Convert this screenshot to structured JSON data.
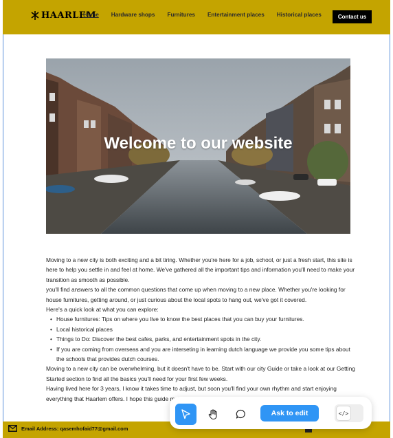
{
  "header": {
    "logo_text": "HAARLEM",
    "nav": [
      {
        "label": "Home",
        "active": true
      },
      {
        "label": "Hardware shops",
        "active": false
      },
      {
        "label": "Furnitures",
        "active": false
      },
      {
        "label": "Entertainment places",
        "active": false
      },
      {
        "label": "Historical places",
        "active": false
      }
    ],
    "contact_label": "Contact us"
  },
  "hero": {
    "title": "Welcome to our website"
  },
  "content": {
    "intro": "Moving to a new city is both exciting and a bit tiring. Whether you're here for a job, school, or just a fresh start, this site is here to help you settle in and feel at home. We've gathered all the important tips and information you'll need to make your transition as smooth as possible.",
    "para2": "you'll find answers to all the common questions that come up when moving to a new place. Whether you're looking for house furnitures, getting around, or just curious about the local spots to hang out, we've got it covered.",
    "para3": "Here's a quick look at what you can explore:",
    "bullets": [
      "House furnitures: Tips on where you live to know the best places that you can buy your furnitures.",
      "Local historical places",
      "Things to Do: Discover the best cafes, parks, and entertainment spots in the city.",
      "If you are coming from overseas and you are interseting in learning dutch language we provide you some tips about the schools that provides dutch courses."
    ],
    "para4": "Moving to a new city can be overwhelming, but it doesn't have to be. Start with our city Guide or take a look at our Getting Started section to find all the basics you'll need for your first few weeks.",
    "para5": "Having lived here for 3 years, I know it takes time to adjust, but soon you'll find your own rhythm and start enjoying everything  that Haarlem offers. I hope this guide makes things easier and helps you feel at home a little sooner!"
  },
  "footer": {
    "email": "Email Address: qasemhofaid77@gmail.com"
  },
  "toolbar": {
    "ask_label": "Ask to edit",
    "code_label": "</>"
  },
  "colors": {
    "header_bg": "#c4a400",
    "accent": "#2f95f5"
  }
}
